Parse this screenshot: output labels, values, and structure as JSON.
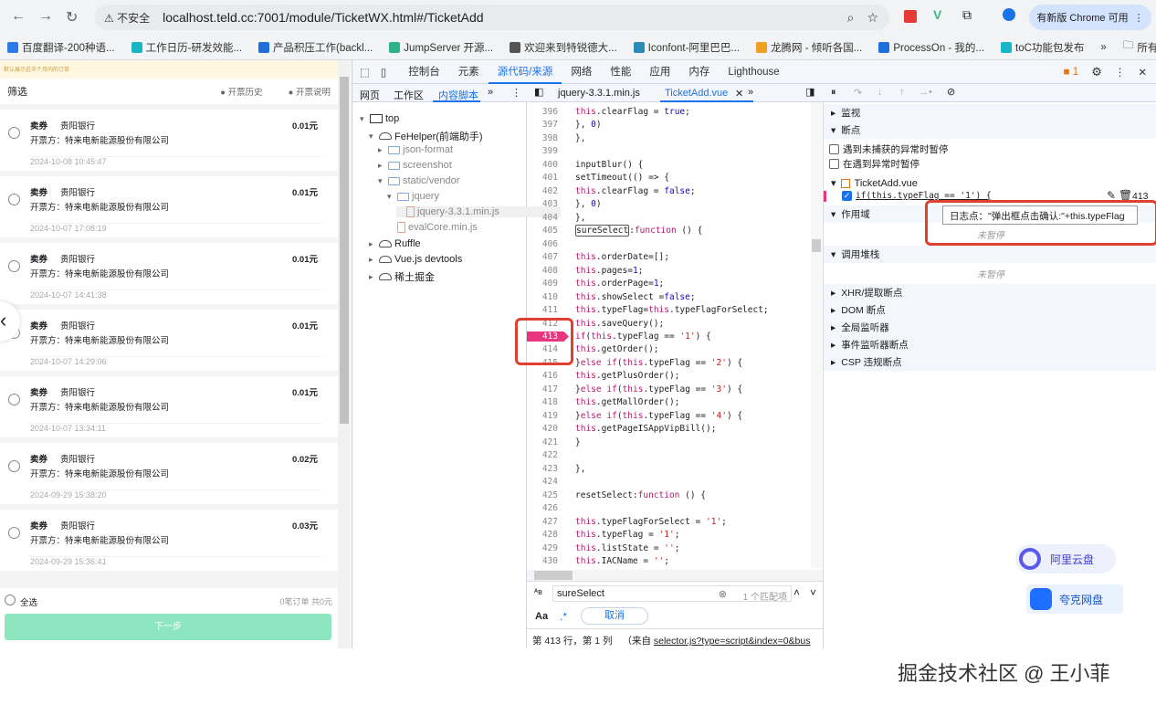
{
  "browser": {
    "insecure_label": "不安全",
    "url": "localhost.teld.cc:7001/module/TicketWX.html#/TicketAdd",
    "update_label": "有新版 Chrome 可用",
    "bookmarks": [
      {
        "label": "百度翻译-200种语...",
        "color": "#2d7be5"
      },
      {
        "label": "工作日历-研发效能...",
        "color": "#19b5c7"
      },
      {
        "label": "产品积压工作(backl...",
        "color": "#1e6fd9"
      },
      {
        "label": "JumpServer 开源...",
        "color": "#2bb389"
      },
      {
        "label": "欢迎来到特锐德大...",
        "color": "#555"
      },
      {
        "label": "Iconfont-阿里巴巴...",
        "color": "#2a8ab8"
      },
      {
        "label": "龙腾网 - 倾听各国...",
        "color": "#f0a020"
      },
      {
        "label": "ProcessOn - 我的...",
        "color": "#1e6fd9"
      },
      {
        "label": "toC功能包发布",
        "color": "#19b5c7"
      }
    ],
    "all_bookmarks": "所有书签"
  },
  "app": {
    "notice": "默认展示近半个月内的订单",
    "filter": "筛选",
    "history": "开票历史",
    "explain": "开票说明",
    "items": [
      {
        "type": "卖券",
        "bank": "贵阳银行",
        "issuer": "开票方：特来电新能源股份有限公司",
        "amount": "0.01元",
        "time": "2024-10-08 10:45:47"
      },
      {
        "type": "卖券",
        "bank": "贵阳银行",
        "issuer": "开票方：特来电新能源股份有限公司",
        "amount": "0.01元",
        "time": "2024-10-07 17:08:19"
      },
      {
        "type": "卖券",
        "bank": "贵阳银行",
        "issuer": "开票方：特来电新能源股份有限公司",
        "amount": "0.01元",
        "time": "2024-10-07 14:41:38"
      },
      {
        "type": "卖券",
        "bank": "贵阳银行",
        "issuer": "开票方：特来电新能源股份有限公司",
        "amount": "0.01元",
        "time": "2024-10-07 14:29:06"
      },
      {
        "type": "卖券",
        "bank": "贵阳银行",
        "issuer": "开票方：特来电新能源股份有限公司",
        "amount": "0.01元",
        "time": "2024-10-07 13:34:11"
      },
      {
        "type": "卖券",
        "bank": "贵阳银行",
        "issuer": "开票方：特来电新能源股份有限公司",
        "amount": "0.02元",
        "time": "2024-09-29 15:38:20"
      },
      {
        "type": "卖券",
        "bank": "贵阳银行",
        "issuer": "开票方：特来电新能源股份有限公司",
        "amount": "0.03元",
        "time": "2024-09-29 15:36:41"
      }
    ],
    "select_all": "全选",
    "summary": "0笔订单 共0元",
    "next": "下一步"
  },
  "devtools": {
    "tabs": [
      "控制台",
      "元素",
      "源代码/来源",
      "网络",
      "性能",
      "应用",
      "内存",
      "Lighthouse"
    ],
    "active_tab": 2,
    "issues": "1",
    "nav_tabs": [
      "网页",
      "工作区",
      "内容脚本"
    ],
    "file_tabs": [
      "jquery-3.3.1.min.js",
      "TicketAdd.vue"
    ],
    "tree": [
      "top",
      "FeHelper(前端助手)",
      "json-format",
      "screenshot",
      "static/vendor",
      "jquery",
      "jquery-3.3.1.min.js",
      "evalCore.min.js",
      "Ruffle",
      "Vue.js devtools",
      "稀土掘金"
    ],
    "first_line": 396,
    "code": [
      "this.clearFlag = true;",
      "}, 0)",
      "},",
      "",
      "inputBlur() {",
      "setTimeout(() => {",
      "this.clearFlag = false;",
      "}, 0)",
      "},",
      "sureSelect:function () {",
      "",
      "this.orderDate=[];",
      "this.pages=1;",
      "this.orderPage=1;",
      "this.showSelect =false;",
      "this.typeFlag=this.typeFlagForSelect;",
      "this.saveQuery();",
      "if(this.typeFlag == '1') {",
      "this.getOrder();",
      "}else if(this.typeFlag == '2') {",
      "this.getPlusOrder();",
      "}else if(this.typeFlag == '3') {",
      "this.getMallOrder();",
      "}else if(this.typeFlag == '4') {",
      "this.getPageISAppVipBill();",
      "}",
      "",
      "},",
      "",
      "resetSelect:function () {",
      "",
      "this.typeFlagForSelect = '1';",
      "this.typeFlag = '1';",
      "this.listState = '';",
      "this.IACName = '';"
    ],
    "breakpoint_line": "413",
    "search_value": "sureSelect",
    "match_count": "1 个匹配项",
    "aa": "Aa",
    "regex": ".*",
    "cancel": "取消",
    "status": "第 413 行，第 1 列",
    "status_from": "（来自",
    "status_link": "selector.js?type=script&index=0&bus",
    "sections": {
      "watch": "监视",
      "breakpoints": "断点",
      "pause_uncaught": "遇到未捕获的异常时暂停",
      "pause_caught": "在遇到异常时暂停",
      "bp_file": "TicketAdd.vue",
      "bp_code": "if(this.typeFlag == '1') {",
      "bp_line": "413",
      "logpoint": "日志点：\"弹出框点击确认:\"+this.typeFlag",
      "scope": "作用域",
      "not_paused": "未暂停",
      "callstack": "调用堆栈",
      "not_paused2": "未暂停",
      "xhr": "XHR/提取断点",
      "dom": "DOM 断点",
      "global": "全局监听器",
      "event": "事件监听器断点",
      "csp": "CSP 违规断点"
    }
  },
  "widgets": {
    "aliyun": "阿里云盘",
    "quark": "夸克网盘"
  },
  "watermark": "掘金技术社区 @ 王小菲"
}
